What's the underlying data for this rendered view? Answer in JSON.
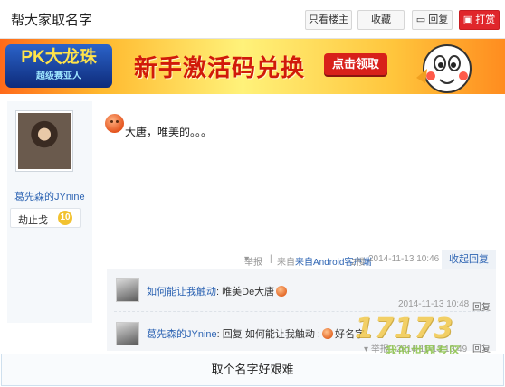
{
  "header": {
    "title": "帮大家取名字",
    "buttons": {
      "only_op": "只看楼主",
      "favorite": "收藏",
      "reply": "回复",
      "reward": "打赏"
    }
  },
  "banner": {
    "logo_text": "PK大龙珠",
    "logo_sub": "超级赛亚人",
    "headline": "新手激活码兑换",
    "cta": "点击领取"
  },
  "post": {
    "author": "葛先森的JYnine",
    "badge_label": "劫止戈",
    "badge_level": "10",
    "content": "大唐，唯美的。。。",
    "report": "举报",
    "source": "来自Android客户端",
    "floor": "2楼",
    "time": "2014-11-13 10:46",
    "fold_reply": "收起回复"
  },
  "replies": [
    {
      "user": "如何能让我触动",
      "text": "唯美De大唐",
      "time": "2014-11-13 10:48",
      "reply_label": "回复"
    },
    {
      "user": "葛先森的JYnine",
      "prefix": "回复",
      "mention": "如何能让我触动",
      "text": "好名字",
      "report": "举报",
      "time": "2014-11-13 10:49",
      "reply_label": "回复"
    }
  ],
  "watermark": {
    "main": "17173",
    "sub": "我的世界专区"
  },
  "footer": {
    "input_text": "取个名字好艰难"
  },
  "colors": {
    "link_blue": "#2d64b3",
    "reward_red": "#e0262b",
    "banner_red": "#d11a0a"
  }
}
